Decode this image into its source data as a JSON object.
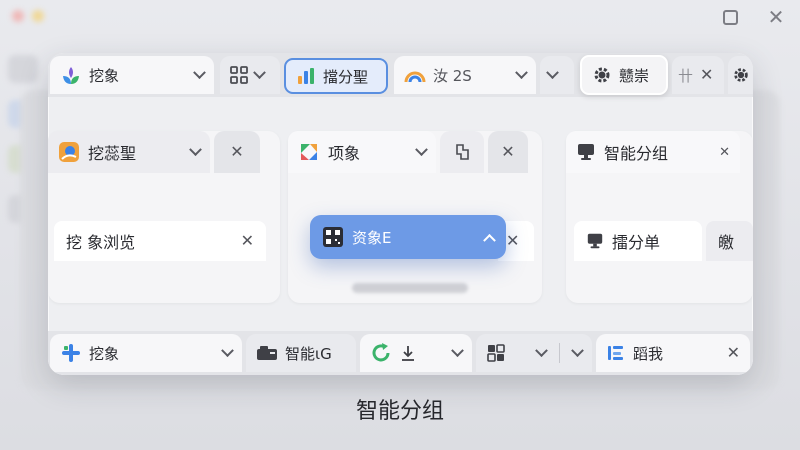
{
  "caption": "智能分组",
  "window": {
    "maximize_icon": "maximize-icon",
    "close_icon": "close-icon"
  },
  "top_tabs": [
    {
      "label": "挖象",
      "icon": "leaf-logo-icon"
    },
    {
      "label": "",
      "icon": "grid-icon"
    },
    {
      "label": "擋分聖",
      "icon": "bar-chart-icon",
      "active": true
    },
    {
      "label": "汝 2S",
      "icon": "rainbow-icon"
    },
    {
      "label": "",
      "icon": "chevron-down-icon"
    },
    {
      "label": "戆崇",
      "icon": "gear-icon",
      "focused": true
    },
    {
      "label": "卄",
      "icon": ""
    }
  ],
  "groups": [
    {
      "header": "挖蕊聖",
      "icon": "orange-globe-icon",
      "tab": "挖 象浏览"
    },
    {
      "header": "项象",
      "icon": "colorful-app-icon",
      "tab": ""
    },
    {
      "header": "智能分组",
      "icon": "monitor-icon",
      "tab": "擂分单",
      "extra": "皦"
    }
  ],
  "dragged_tab": {
    "label": "资象Ε",
    "icon": "qr-icon"
  },
  "bottom_tabs": [
    {
      "label": "挖象",
      "icon": "blue-star-icon"
    },
    {
      "label": "智能ιG",
      "icon": "camera-icon"
    },
    {
      "label": "",
      "icon": "refresh-icon"
    },
    {
      "label": "",
      "icon": "grid-icon"
    },
    {
      "label": "蹈我",
      "icon": "blue-doc-icon"
    }
  ]
}
